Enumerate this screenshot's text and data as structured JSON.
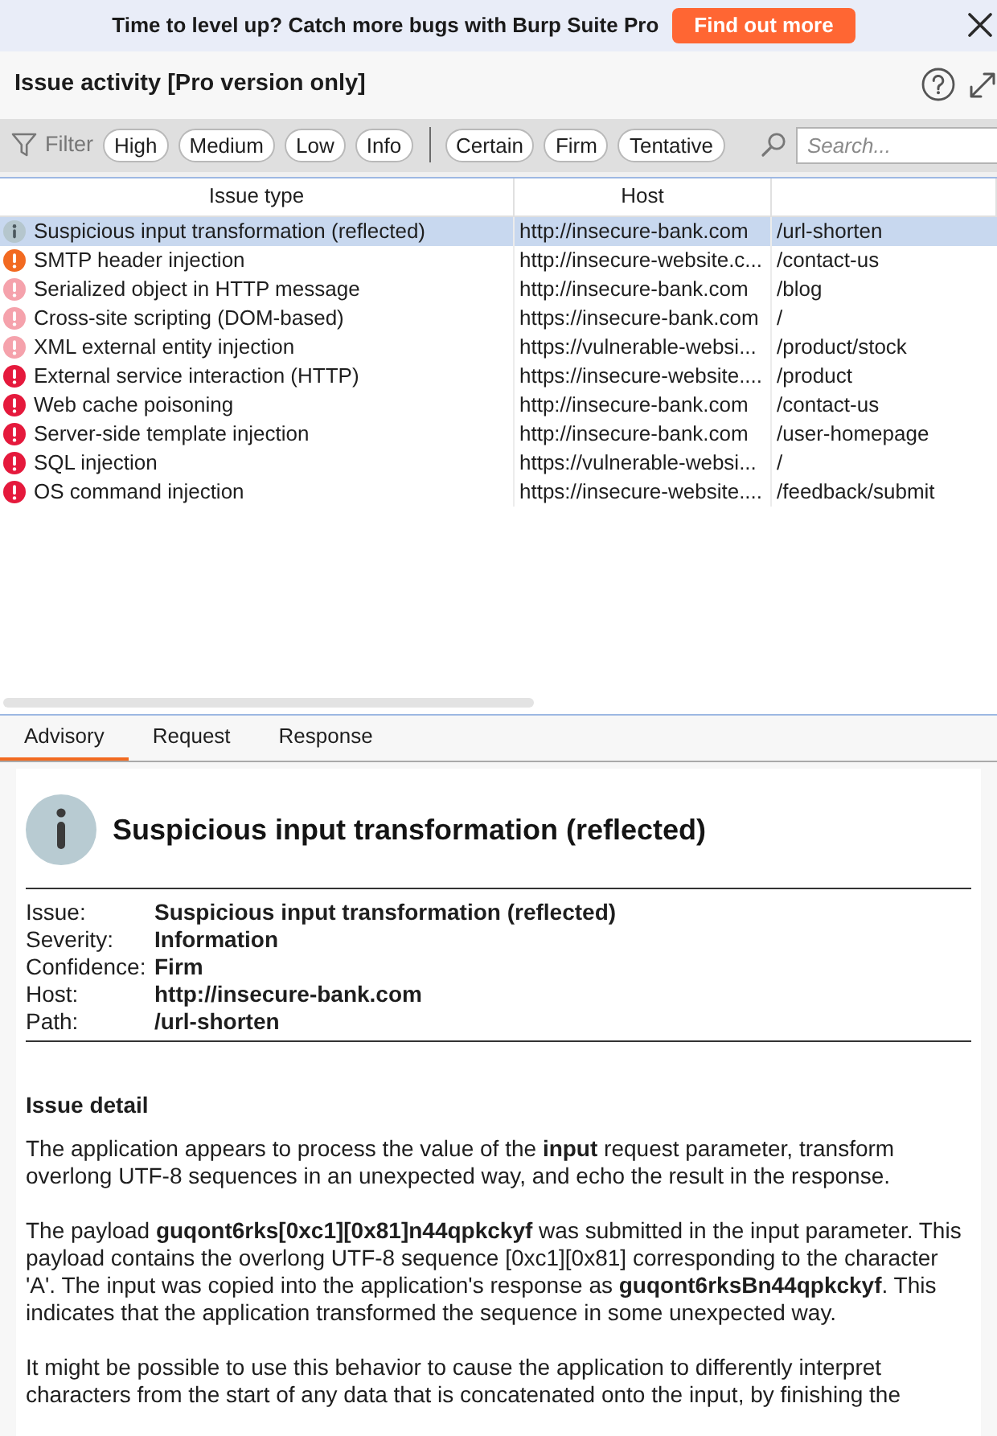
{
  "promo_banner": {
    "text": "Time to level up? Catch more bugs with Burp Suite Pro",
    "button": "Find out more"
  },
  "panel": {
    "title": "Issue activity [Pro version only]"
  },
  "filter_bar": {
    "label": "Filter",
    "severity_filters": [
      "High",
      "Medium",
      "Low",
      "Info"
    ],
    "confidence_filters": [
      "Certain",
      "Firm",
      "Tentative"
    ],
    "search": {
      "placeholder": "Search..."
    }
  },
  "table": {
    "columns": [
      "Issue type",
      "Host"
    ],
    "rows": [
      {
        "kind": "info",
        "color": "#b5c6cd",
        "issue_type": "Suspicious input transformation (reflected)",
        "host": "http://insecure-bank.com",
        "column_3": "/url-shorten",
        "selected": true
      },
      {
        "kind": "alert",
        "color": "#f26a21",
        "issue_type": "SMTP header injection",
        "host": "http://insecure-website.c...",
        "column_3": "/contact-us",
        "selected": false
      },
      {
        "kind": "alert",
        "color": "#f5a2ac",
        "issue_type": "Serialized object in HTTP message",
        "host": "http://insecure-bank.com",
        "column_3": "/blog",
        "selected": false
      },
      {
        "kind": "alert",
        "color": "#f5a2ac",
        "issue_type": "Cross-site scripting (DOM-based)",
        "host": "https://insecure-bank.com",
        "column_3": "/",
        "selected": false
      },
      {
        "kind": "alert",
        "color": "#f5a2ac",
        "issue_type": "XML external entity injection",
        "host": "https://vulnerable-websi...",
        "column_3": "/product/stock",
        "selected": false
      },
      {
        "kind": "alert",
        "color": "#e5193c",
        "issue_type": "External service interaction (HTTP)",
        "host": "https://insecure-website....",
        "column_3": "/product",
        "selected": false
      },
      {
        "kind": "alert",
        "color": "#e5193c",
        "issue_type": "Web cache poisoning",
        "host": "http://insecure-bank.com",
        "column_3": "/contact-us",
        "selected": false
      },
      {
        "kind": "alert",
        "color": "#e5193c",
        "issue_type": "Server-side template injection",
        "host": "http://insecure-bank.com",
        "column_3": "/user-homepage",
        "selected": false
      },
      {
        "kind": "alert",
        "color": "#e5193c",
        "issue_type": "SQL injection",
        "host": "https://vulnerable-websi...",
        "column_3": "/",
        "selected": false
      },
      {
        "kind": "alert",
        "color": "#e5193c",
        "issue_type": "OS command injection",
        "host": "https://insecure-website....",
        "column_3": "/feedback/submit",
        "selected": false
      }
    ]
  },
  "detail_tabs": [
    {
      "label": "Advisory",
      "selected": true
    },
    {
      "label": "Request",
      "selected": false
    },
    {
      "label": "Response",
      "selected": false
    }
  ],
  "advisory": {
    "title": "Suspicious input transformation (reflected)",
    "fields": [
      {
        "label": "Issue:",
        "value": "Suspicious input transformation (reflected)"
      },
      {
        "label": "Severity:",
        "value": "Information"
      },
      {
        "label": "Confidence:",
        "value": "Firm"
      },
      {
        "label": "Host:",
        "value": "http://insecure-bank.com"
      },
      {
        "label": "Path:",
        "value": "/url-shorten"
      }
    ],
    "section_heading": "Issue detail",
    "paragraphs": [
      "The application appears to process the value of the **input** request parameter, transform overlong UTF-8 sequences in an unexpected way, and echo the result in the response.",
      "The payload **guqont6rks[0xc1][0x81]n44qpkckyf** was submitted in the input parameter. This payload contains the overlong UTF-8 sequence [0xc1][0x81] corresponding to the character 'A'. The input was copied into the application's response as **guqont6rksBn44qpkckyf**. This indicates that the application transformed the sequence in some unexpected way.",
      "It might be possible to use this behavior to cause the application to differently interpret characters from the start of any data that is concatenated onto the input, by finishing the"
    ]
  }
}
